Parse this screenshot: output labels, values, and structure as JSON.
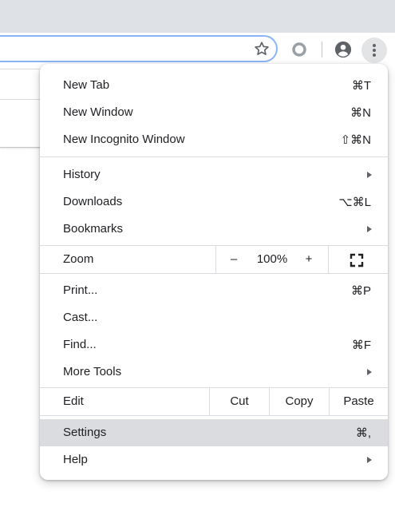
{
  "browser": {
    "star_icon": "star-outline-icon",
    "extension_icon": "circle-extension-icon",
    "profile_icon": "account-circle-icon",
    "menu_icon": "vertical-dots-icon"
  },
  "menu": {
    "new_tab": {
      "label": "New Tab",
      "shortcut": "⌘T"
    },
    "new_window": {
      "label": "New Window",
      "shortcut": "⌘N"
    },
    "new_incognito": {
      "label": "New Incognito Window",
      "shortcut": "⇧⌘N"
    },
    "history": {
      "label": "History",
      "submenu": true
    },
    "downloads": {
      "label": "Downloads",
      "shortcut": "⌥⌘L"
    },
    "bookmarks": {
      "label": "Bookmarks",
      "submenu": true
    },
    "zoom": {
      "label": "Zoom",
      "minus": "–",
      "value": "100%",
      "plus": "+",
      "fullscreen_icon": "fullscreen-icon"
    },
    "print": {
      "label": "Print...",
      "shortcut": "⌘P"
    },
    "cast": {
      "label": "Cast..."
    },
    "find": {
      "label": "Find...",
      "shortcut": "⌘F"
    },
    "more_tools": {
      "label": "More Tools",
      "submenu": true
    },
    "edit": {
      "label": "Edit",
      "cut": "Cut",
      "copy": "Copy",
      "paste": "Paste"
    },
    "settings": {
      "label": "Settings",
      "shortcut": "⌘,",
      "highlighted": true
    },
    "help": {
      "label": "Help",
      "submenu": true
    }
  }
}
